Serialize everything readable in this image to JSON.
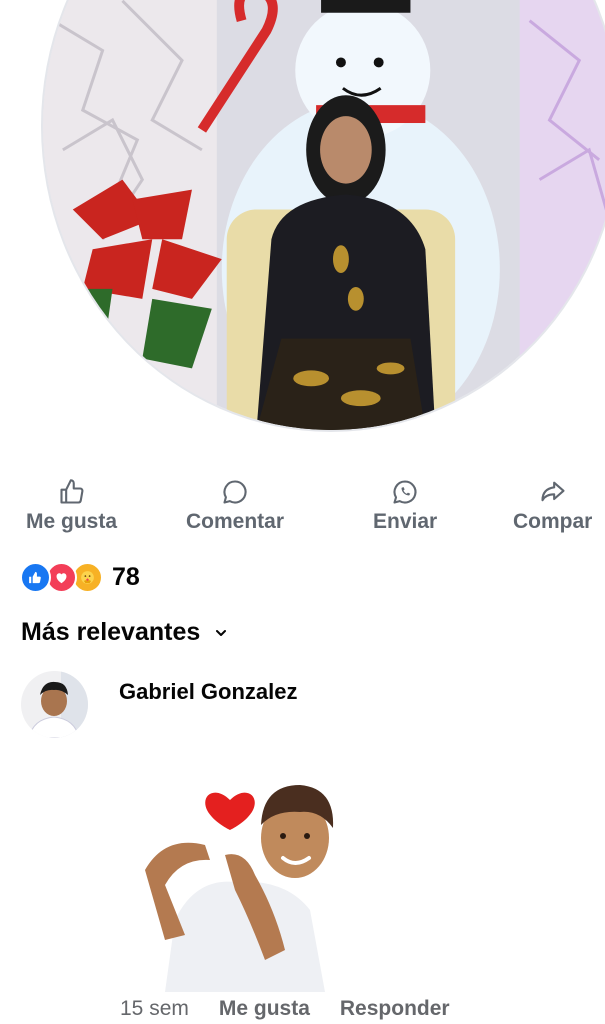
{
  "actions": {
    "like_label": "Me gusta",
    "comment_label": "Comentar",
    "send_label": "Enviar",
    "share_label": "Compar"
  },
  "reactions": {
    "icons": [
      "like-reaction-icon",
      "love-reaction-icon",
      "care-reaction-icon"
    ],
    "count": "78"
  },
  "sort": {
    "label": "Más relevantes"
  },
  "comment": {
    "author": "Gabriel Gonzalez",
    "time": "15 sem",
    "like_label": "Me gusta",
    "reply_label": "Responder"
  },
  "colors": {
    "brand_blue": "#1877f2",
    "love_red": "#f33e58",
    "care_yellow": "#f7b125",
    "secondary_text": "#65676b"
  }
}
